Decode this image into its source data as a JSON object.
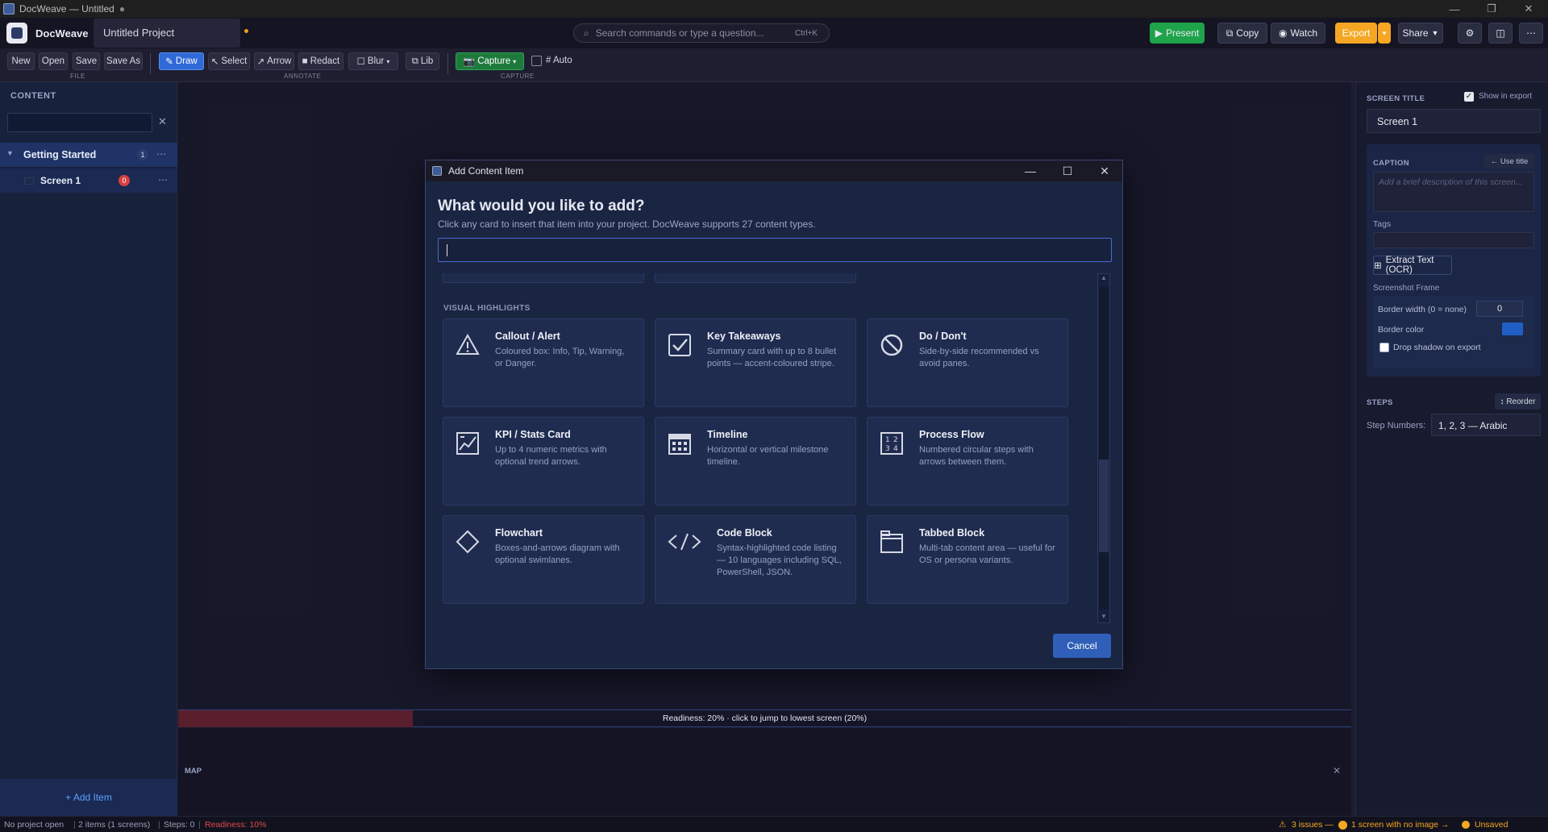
{
  "window": {
    "title": "DocWeave — Untitled",
    "unsaved_marker": "●"
  },
  "header": {
    "brand": "DocWeave",
    "project_tab": "Untitled Project",
    "command_search_placeholder": "Search commands or type a question...",
    "command_search_shortcut": "Ctrl+K",
    "present_label": "Present",
    "copy_label": "Copy",
    "watch_label": "Watch",
    "export_label": "Export",
    "share_label": "Share",
    "accent_green": "#1fa34a",
    "accent_orange": "#f5a623"
  },
  "toolbar": {
    "file": {
      "group_label": "FILE",
      "new": "New",
      "open": "Open",
      "save": "Save",
      "save_as": "Save As"
    },
    "annotate": {
      "group_label": "ANNOTATE",
      "draw": "Draw",
      "select": "Select",
      "arrow": "Arrow",
      "redact": "Redact",
      "blur": "Blur",
      "lib": "Lib"
    },
    "capture": {
      "group_label": "CAPTURE",
      "capture": "Capture",
      "auto": "# Auto",
      "auto_checked": false
    }
  },
  "sidebar": {
    "heading": "CONTENT",
    "search_value": "",
    "group": {
      "label": "Getting Started",
      "count": "1"
    },
    "items": [
      {
        "label": "Screen 1",
        "badge": "0"
      }
    ],
    "add_item": "+ Add Item"
  },
  "dialog": {
    "title": "Add Content Item",
    "heading": "What would you like to add?",
    "subtitle": "Click any card to insert that item into your project. DocWeave supports 27 content types.",
    "search_value": "",
    "section_label": "VISUAL HIGHLIGHTS",
    "cards": [
      {
        "title": "Callout / Alert",
        "desc": "Coloured box: Info, Tip, Warning, or Danger.",
        "icon": "warning-triangle-icon"
      },
      {
        "title": "Key Takeaways",
        "desc": "Summary card with up to 8 bullet points — accent-coloured stripe.",
        "icon": "checkbox-icon"
      },
      {
        "title": "Do / Don't",
        "desc": "Side-by-side recommended vs avoid panes.",
        "icon": "prohibited-icon"
      },
      {
        "title": "KPI / Stats Card",
        "desc": "Up to 4 numeric metrics with optional trend arrows.",
        "icon": "trend-chart-icon"
      },
      {
        "title": "Timeline",
        "desc": "Horizontal or vertical milestone timeline.",
        "icon": "calendar-icon"
      },
      {
        "title": "Process Flow",
        "desc": "Numbered circular steps with arrows between them.",
        "icon": "numbered-steps-icon"
      },
      {
        "title": "Flowchart",
        "desc": "Boxes-and-arrows diagram with optional swimlanes.",
        "icon": "diamond-icon"
      },
      {
        "title": "Code Block",
        "desc": "Syntax-highlighted code listing — 10 languages including SQL, PowerShell, JSON.",
        "icon": "code-brackets-icon"
      },
      {
        "title": "Tabbed Block",
        "desc": "Multi-tab content area — useful for OS or persona variants.",
        "icon": "tabbed-window-icon"
      }
    ],
    "cancel": "Cancel"
  },
  "center": {
    "readiness": "Readiness: 20%  ·  click to jump to lowest screen (20%)",
    "readiness_percent": 20,
    "map_label": "MAP"
  },
  "right_panel": {
    "screen_title_label": "SCREEN TITLE",
    "show_in_export": "Show in export",
    "show_in_export_checked": true,
    "screen_title_value": "Screen 1",
    "caption_label": "CAPTION",
    "use_title": "← Use title",
    "caption_placeholder": "Add a brief description of this screen...",
    "tags_label": "Tags",
    "ocr_button": "Extract Text (OCR)",
    "frame_label": "Screenshot Frame",
    "border_width_label": "Border width (0 = none)",
    "border_width_value": "0",
    "border_color_label": "Border color",
    "border_color": "#1f5fc4",
    "drop_shadow": "Drop shadow on export",
    "drop_shadow_checked": false,
    "steps_label": "STEPS",
    "reorder": "↕ Reorder",
    "step_numbers_label": "Step Numbers:",
    "step_numbers_value": "1, 2, 3  — Arabic"
  },
  "status": {
    "project": "No project open",
    "items": "2 items  (1 screens)",
    "steps": "Steps: 0",
    "readiness": "Readiness: 10%",
    "issues": "3 issues —",
    "no_image": "1 screen with no image →",
    "unsaved": "Unsaved"
  }
}
